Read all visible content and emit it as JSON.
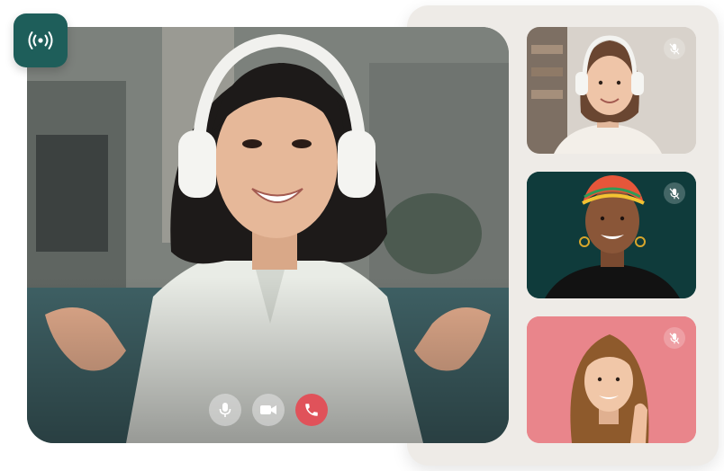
{
  "app": {
    "live_icon": "broadcast-icon"
  },
  "main_video": {
    "participant_avatar": "woman-with-headphones"
  },
  "controls": {
    "buttons": [
      {
        "icon": "microphone-icon"
      },
      {
        "icon": "video-camera-icon"
      },
      {
        "icon": "phone-hangup-icon",
        "color": "#e0525a"
      }
    ]
  },
  "participants": [
    {
      "background": "#cfc9c2",
      "status_icon": "microphone-muted-icon"
    },
    {
      "background": "#0f3d3d",
      "status_icon": "microphone-muted-icon"
    },
    {
      "background": "#e8848a",
      "status_icon": "microphone-muted-icon"
    }
  ],
  "colors": {
    "accent": "#1e5e5a",
    "hangup": "#e0525a",
    "panel": "#eeebe7"
  }
}
